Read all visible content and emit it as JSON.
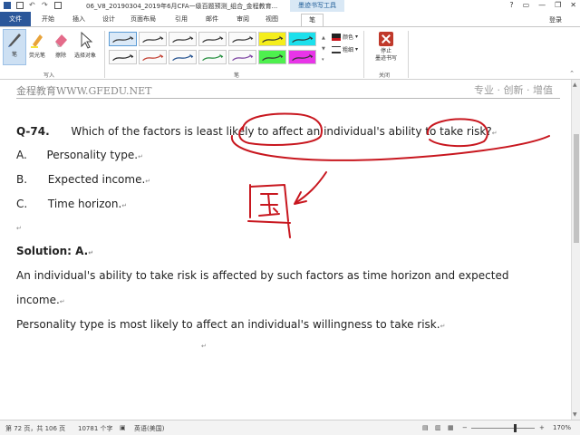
{
  "titlebar": {
    "doc_title": "06_V8_20190304_2019年6月CFA一级百题预测_组合_金程教育...",
    "context_tab": "墨迹书写工具",
    "help": "?",
    "minimize": "—",
    "restore": "❐",
    "close": "✕"
  },
  "tabs": {
    "file": "文件",
    "items": [
      "开始",
      "插入",
      "设计",
      "页面布局",
      "引用",
      "邮件",
      "审阅",
      "视图",
      "笔"
    ],
    "login": "登录"
  },
  "ribbon": {
    "tools": [
      {
        "label": "笔",
        "icon": "pen-icon"
      },
      {
        "label": "荧光笔",
        "icon": "highlighter-icon"
      },
      {
        "label": "擦除",
        "icon": "eraser-icon"
      },
      {
        "label": "选择对象",
        "icon": "select-arrow-icon"
      }
    ],
    "write_group": "写入",
    "pens_group": "笔",
    "color_label": "颜色",
    "weight_label": "粗细",
    "stop_label_line1": "停止",
    "stop_label_line2": "墨迹书写",
    "close_group": "关闭",
    "pen_styles": [
      {
        "color": "#333333",
        "bg": "#fafafa",
        "selected": true
      },
      {
        "color": "#333333",
        "bg": "#fafafa"
      },
      {
        "color": "#333333",
        "bg": "#fafafa"
      },
      {
        "color": "#333333",
        "bg": "#fafafa"
      },
      {
        "color": "#333333",
        "bg": "#fafafa"
      },
      {
        "color": "#333333",
        "bg": "#f5ee1c"
      },
      {
        "color": "#333333",
        "bg": "#1ce0ec"
      },
      {
        "color": "#222222",
        "bg": "#fafafa"
      },
      {
        "color": "#c0392b",
        "bg": "#fafafa"
      },
      {
        "color": "#1f4e8c",
        "bg": "#fafafa"
      },
      {
        "color": "#1f8c3a",
        "bg": "#fafafa"
      },
      {
        "color": "#7a3fa0",
        "bg": "#fafafa"
      },
      {
        "color": "#333333",
        "bg": "#4ef04e"
      },
      {
        "color": "#333333",
        "bg": "#e834e8"
      }
    ]
  },
  "header": {
    "left": "金程教育WWW.GFEDU.NET",
    "right": "专业 · 创新 · 增值",
    "mark": "↵"
  },
  "question": {
    "number": "Q-74.",
    "text": "Which of the factors is least likely to affect an individual's ability to take risk?",
    "options": [
      {
        "letter": "A.",
        "text": "Personality type."
      },
      {
        "letter": "B.",
        "text": "Expected income."
      },
      {
        "letter": "C.",
        "text": "Time horizon."
      }
    ]
  },
  "solution": {
    "title": "Solution: A.",
    "para1_line1": "An individual's ability to take risk is affected by such factors as time horizon and expected",
    "para1_line2": "income.",
    "para2": "Personality type is most likely to affect an individual's willingness to take risk."
  },
  "statusbar": {
    "page": "第 72 页，共 106 页",
    "words": "10781 个字",
    "lang": "英语(美国)",
    "zoom": "170%",
    "zoom_minus": "−",
    "zoom_plus": "+"
  },
  "colors": {
    "ink_red": "#c8171f",
    "word_blue": "#2b579a"
  }
}
